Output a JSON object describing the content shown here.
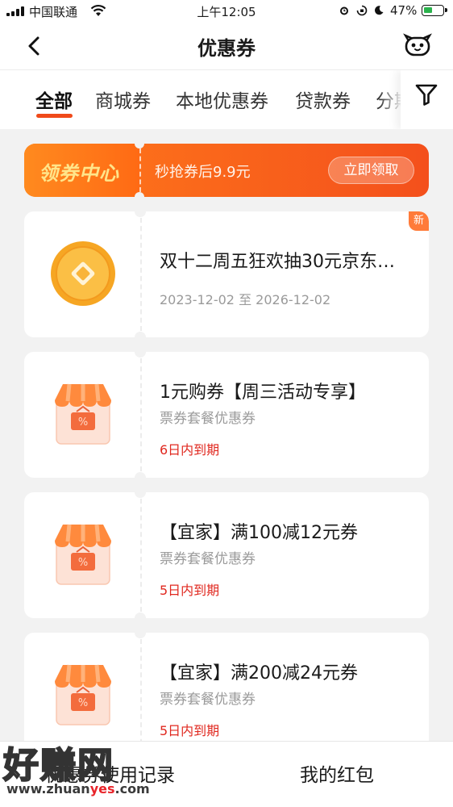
{
  "status_bar": {
    "carrier": "中国联通",
    "time": "上午12:05",
    "battery": "47%",
    "battery_level": 0.47,
    "icons": [
      "signal-icon",
      "wifi-icon",
      "alarm-icon",
      "orientation-lock-icon",
      "moon-icon",
      "battery-icon"
    ]
  },
  "header": {
    "title": "优惠券",
    "back_icon": "chevron-left-icon",
    "service_icon": "robot-icon"
  },
  "tabs": [
    {
      "label": "全部",
      "active": true
    },
    {
      "label": "商城券",
      "active": false
    },
    {
      "label": "本地优惠券",
      "active": false
    },
    {
      "label": "贷款券",
      "active": false
    },
    {
      "label": "分期",
      "active": false
    }
  ],
  "filter_icon": "filter-icon",
  "banner": {
    "brand": "领券中心",
    "description": "秒抢券后9.9元",
    "button": "立即领取"
  },
  "coupons": [
    {
      "icon": "gold-coin-icon",
      "title": "双十二周五狂欢抽30元京东…",
      "subtitle": "2023-12-02 至 2026-12-02",
      "expire": "",
      "badge": "新"
    },
    {
      "icon": "store-icon",
      "title": "1元购券【周三活动专享】",
      "subtitle": "票券套餐优惠券",
      "expire": "6日内到期",
      "badge": ""
    },
    {
      "icon": "store-icon",
      "title": "【宜家】满100减12元券",
      "subtitle": "票券套餐优惠券",
      "expire": "5日内到期",
      "badge": ""
    },
    {
      "icon": "store-icon",
      "title": "【宜家】满200减24元券",
      "subtitle": "票券套餐优惠券",
      "expire": "5日内到期",
      "badge": ""
    }
  ],
  "bottom_bar": {
    "history": "优惠券使用记录",
    "red_packet": "我的红包"
  },
  "watermark": {
    "big": "好赚网",
    "small_prefix": "www.zhuan",
    "small_highlight": "yes",
    "small_suffix": ".com"
  },
  "colors": {
    "accent": "#f04a1a",
    "banner_start": "#ff7a1a",
    "banner_end": "#f4501c",
    "expire_red": "#e0281f",
    "badge": "#ff7b3a",
    "page_bg": "#f2f2f2"
  }
}
